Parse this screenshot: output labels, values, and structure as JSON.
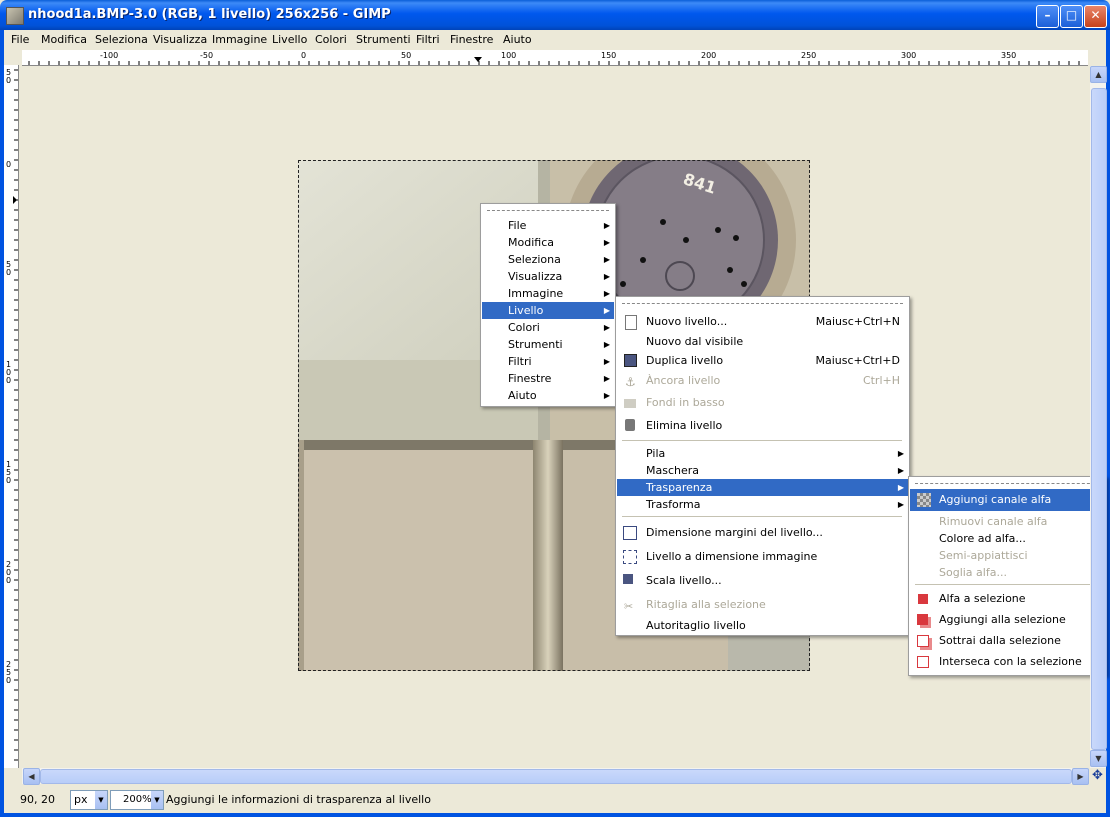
{
  "window": {
    "title": "nhood1a.BMP-3.0 (RGB, 1 livello) 256x256 - GIMP",
    "controls": [
      "minimize",
      "maximize",
      "close"
    ]
  },
  "menubar": [
    "File",
    "Modifica",
    "Seleziona",
    "Visualizza",
    "Immagine",
    "Livello",
    "Colori",
    "Strumenti",
    "Filtri",
    "Finestre",
    "Aiuto"
  ],
  "rulers": {
    "horizontal": [
      "-100",
      "-50",
      "0",
      "50",
      "100",
      "150",
      "200",
      "250",
      "300",
      "350"
    ],
    "vertical": [
      "50",
      "0",
      "50",
      "100",
      "150",
      "200",
      "250"
    ]
  },
  "context_menu": {
    "items": [
      "File",
      "Modifica",
      "Seleziona",
      "Visualizza",
      "Immagine",
      "Livello",
      "Colori",
      "Strumenti",
      "Filtri",
      "Finestre",
      "Aiuto"
    ],
    "selected": "Livello"
  },
  "livello_menu": {
    "nuovo": {
      "label": "Nuovo livello...",
      "accel": "Maiusc+Ctrl+N"
    },
    "nuovo_visibile": {
      "label": "Nuovo dal visibile"
    },
    "duplica": {
      "label": "Duplica livello",
      "accel": "Maiusc+Ctrl+D"
    },
    "ancora": {
      "label": "Àncora livello",
      "accel": "Ctrl+H"
    },
    "fondi": {
      "label": "Fondi in basso"
    },
    "elimina": {
      "label": "Elimina livello"
    },
    "pila": {
      "label": "Pila"
    },
    "maschera": {
      "label": "Maschera"
    },
    "trasparenza": {
      "label": "Trasparenza"
    },
    "trasforma": {
      "label": "Trasforma"
    },
    "dim_margini": {
      "label": "Dimensione margini del livello..."
    },
    "a_dim_immagine": {
      "label": "Livello a dimensione immagine"
    },
    "scala": {
      "label": "Scala livello..."
    },
    "ritaglia": {
      "label": "Ritaglia alla selezione"
    },
    "autoritaglio": {
      "label": "Autoritaglio livello"
    }
  },
  "trasparenza_menu": {
    "aggiungi_alfa": "Aggiungi canale alfa",
    "rimuovi_alfa": "Rimuovi canale alfa",
    "colore_alfa": "Colore ad alfa...",
    "semi": "Semi-appiattisci",
    "soglia": "Soglia alfa...",
    "alfa_sel": "Alfa a selezione",
    "aggiungi_sel": "Aggiungi alla selezione",
    "sottrai_sel": "Sottrai dalla selezione",
    "interseca_sel": "Interseca con la selezione"
  },
  "statusbar": {
    "coords": "90, 20",
    "unit": "px",
    "zoom": "200%",
    "message": "Aggiungi le informazioni di trasparenza al livello"
  },
  "image_marking": "841"
}
